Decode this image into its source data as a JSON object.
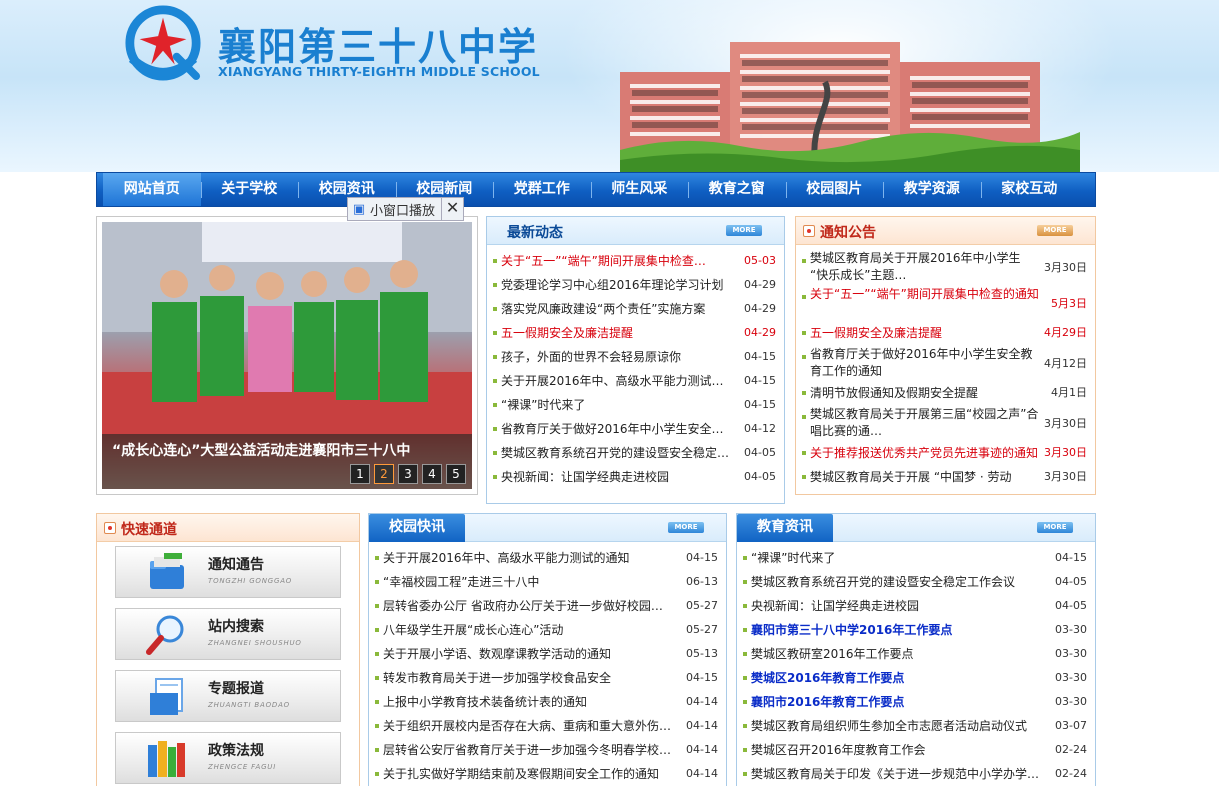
{
  "header": {
    "school_name": "襄阳第三十八中学",
    "school_name_en": "XIANGYANG THIRTY-EIGHTH MIDDLE SCHOOL"
  },
  "nav": {
    "items": [
      {
        "label": "网站首页",
        "active": true
      },
      {
        "label": "关于学校"
      },
      {
        "label": "校园资讯"
      },
      {
        "label": "校园新闻"
      },
      {
        "label": "党群工作"
      },
      {
        "label": "师生风采"
      },
      {
        "label": "教育之窗"
      },
      {
        "label": "校园图片"
      },
      {
        "label": "教学资源"
      },
      {
        "label": "家校互动"
      }
    ]
  },
  "slideshow": {
    "caption": "“成长心连心”大型公益活动走进襄阳市三十八中",
    "pager": [
      "1",
      "2",
      "3",
      "4",
      "5"
    ],
    "active_page": "2",
    "mini_window_label": "小窗口播放"
  },
  "latest_news": {
    "title": "最新动态",
    "more": "MORE",
    "items": [
      {
        "title": "关于“五一”“端午”期间开展集中检查…",
        "date": "05-03",
        "style": "red"
      },
      {
        "title": "党委理论学习中心组2016年理论学习计划",
        "date": "04-29"
      },
      {
        "title": "落实党风廉政建设“两个责任”实施方案",
        "date": "04-29"
      },
      {
        "title": "五一假期安全及廉洁提醒",
        "date": "04-29",
        "style": "red"
      },
      {
        "title": "孩子，外面的世界不会轻易原谅你",
        "date": "04-15"
      },
      {
        "title": "关于开展2016年中、高级水平能力测试的…",
        "date": "04-15"
      },
      {
        "title": "“裸课”时代来了",
        "date": "04-15"
      },
      {
        "title": "省教育厅关于做好2016年中小学生安全教…",
        "date": "04-12"
      },
      {
        "title": "樊城区教育系统召开党的建设暨安全稳定…",
        "date": "04-05"
      },
      {
        "title": "央视新闻：让国学经典走进校园",
        "date": "04-05"
      }
    ]
  },
  "notices": {
    "title": "通知公告",
    "more": "MORE",
    "items": [
      {
        "title": "樊城区教育局关于开展2016年中小学生 “快乐成长”主题…",
        "date": "3月30日",
        "two": true
      },
      {
        "title": "关于“五一”“端午”期间开展集中检查的通知",
        "date": "5月3日",
        "style": "red",
        "two": true
      },
      {
        "title": "五一假期安全及廉洁提醒",
        "date": "4月29日",
        "style": "red"
      },
      {
        "title": "省教育厅关于做好2016年中小学生安全教育工作的通知",
        "date": "4月12日",
        "two": true
      },
      {
        "title": "清明节放假通知及假期安全提醒",
        "date": "4月1日"
      },
      {
        "title": "樊城区教育局关于开展第三届“校园之声”合唱比赛的通…",
        "date": "3月30日",
        "two": true
      },
      {
        "title": "关于推荐报送优秀共产党员先进事迹的通知",
        "date": "3月30日",
        "style": "red"
      },
      {
        "title": "樊城区教育局关于开展 “中国梦 · 劳动",
        "date": "3月30日"
      }
    ]
  },
  "quick": {
    "title": "快速通道",
    "items": [
      {
        "cn": "通知通告",
        "en": "TONGZHI GONGGAO",
        "icon": "folder-icon"
      },
      {
        "cn": "站内搜索",
        "en": "ZHANGNEI SHOUSHUO",
        "icon": "magnifier-icon"
      },
      {
        "cn": "专题报道",
        "en": "ZHUANGTI BAODAO",
        "icon": "document-icon"
      },
      {
        "cn": "政策法规",
        "en": "ZHENGCE FAGUI",
        "icon": "books-icon"
      }
    ]
  },
  "campus_news": {
    "title": "校园快讯",
    "more": "MORE",
    "items": [
      {
        "title": "关于开展2016年中、高级水平能力测试的通知",
        "date": "04-15"
      },
      {
        "title": "“幸福校园工程”走进三十八中",
        "date": "06-13"
      },
      {
        "title": "层转省委办公厅 省政府办公厅关于进一步做好校园及…",
        "date": "05-27"
      },
      {
        "title": "八年级学生开展“成长心连心”活动",
        "date": "05-27"
      },
      {
        "title": "关于开展小学语、数观摩课教学活动的通知",
        "date": "05-13"
      },
      {
        "title": "转发市教育局关于进一步加强学校食品安全",
        "date": "04-15"
      },
      {
        "title": "上报中小学教育技术装备统计表的通知",
        "date": "04-14"
      },
      {
        "title": "关于组织开展校内是否存在大病、重病和重大意外伤…",
        "date": "04-14"
      },
      {
        "title": "层转省公安厅省教育厅关于进一步加强今冬明春学校…",
        "date": "04-14"
      },
      {
        "title": "关于扎实做好学期结束前及寒假期间安全工作的通知",
        "date": "04-14"
      }
    ]
  },
  "edu_news": {
    "title": "教育资讯",
    "more": "MORE",
    "items": [
      {
        "title": "“裸课”时代来了",
        "date": "04-15"
      },
      {
        "title": "樊城区教育系统召开党的建设暨安全稳定工作会议",
        "date": "04-05"
      },
      {
        "title": "央视新闻：让国学经典走进校园",
        "date": "04-05"
      },
      {
        "title": "襄阳市第三十八中学2016年工作要点",
        "date": "03-30",
        "style": "blue"
      },
      {
        "title": "樊城区教研室2016年工作要点",
        "date": "03-30"
      },
      {
        "title": "樊城区2016年教育工作要点",
        "date": "03-30",
        "style": "blue"
      },
      {
        "title": "襄阳市2016年教育工作要点",
        "date": "03-30",
        "style": "blue"
      },
      {
        "title": "樊城区教育局组织师生参加全市志愿者活动启动仪式",
        "date": "03-07"
      },
      {
        "title": "樊城区召开2016年度教育工作会",
        "date": "02-24"
      },
      {
        "title": "樊城区教育局关于印发《关于进一步规范中小学办学…",
        "date": "02-24"
      }
    ]
  }
}
